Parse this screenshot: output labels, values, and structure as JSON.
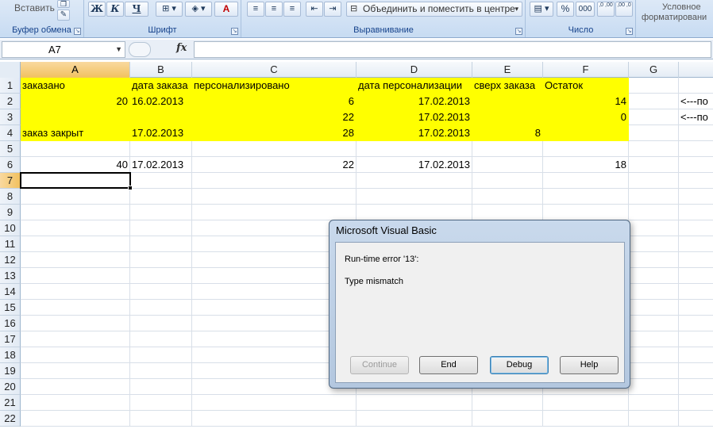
{
  "ribbon": {
    "clipboard": {
      "label": "Буфер обмена",
      "paste_label": "Вставить"
    },
    "font": {
      "label": "Шрифт",
      "bold": "Ж",
      "italic": "К",
      "underline": "Ч",
      "font_color_glyph": "A"
    },
    "alignment": {
      "label": "Выравнивание",
      "merge_label": "Объединить и поместить в центре"
    },
    "number": {
      "label": "Число",
      "percent": "%",
      "thousands": "000",
      "inc_decimal": ",0 ,00",
      "dec_decimal": ",00 ,0"
    },
    "styles": {
      "conditional_line1": "Условное",
      "conditional_line2": "форматировани"
    }
  },
  "formula_bar": {
    "name_box": "A7",
    "fx_symbol": "fx",
    "formula": ""
  },
  "columns": [
    "A",
    "B",
    "C",
    "D",
    "E",
    "F",
    "G"
  ],
  "rows": [
    "1",
    "2",
    "3",
    "4",
    "5",
    "6",
    "7",
    "8",
    "9",
    "10",
    "11",
    "12",
    "13",
    "14",
    "15",
    "16",
    "17",
    "18",
    "19",
    "20",
    "21",
    "22"
  ],
  "cells": {
    "r1": {
      "A": "заказано",
      "B": "дата заказа",
      "C": "персонализировано",
      "D": "дата персонализации",
      "E": "сверх заказа",
      "F": "Остаток"
    },
    "r2": {
      "A": "20",
      "B": "16.02.2013",
      "C": "6",
      "D": "17.02.2013",
      "F": "14",
      "H": "<---по"
    },
    "r3": {
      "C": "22",
      "D": "17.02.2013",
      "F": "0",
      "H": "<---по"
    },
    "r4": {
      "A": "заказ закрыт",
      "B": "17.02.2013",
      "C": "28",
      "D": "17.02.2013",
      "E": "8"
    },
    "r6": {
      "A": "40",
      "B": "17.02.2013",
      "C": "22",
      "D": "17.02.2013",
      "F": "18"
    }
  },
  "selected_cell": "A7",
  "highlight_color": "#ffff00",
  "dialog": {
    "title": "Microsoft Visual Basic",
    "error_line1": "Run-time error '13':",
    "error_line2": "Type mismatch",
    "buttons": {
      "continue": "Continue",
      "end": "End",
      "debug": "Debug",
      "help": "Help"
    }
  }
}
